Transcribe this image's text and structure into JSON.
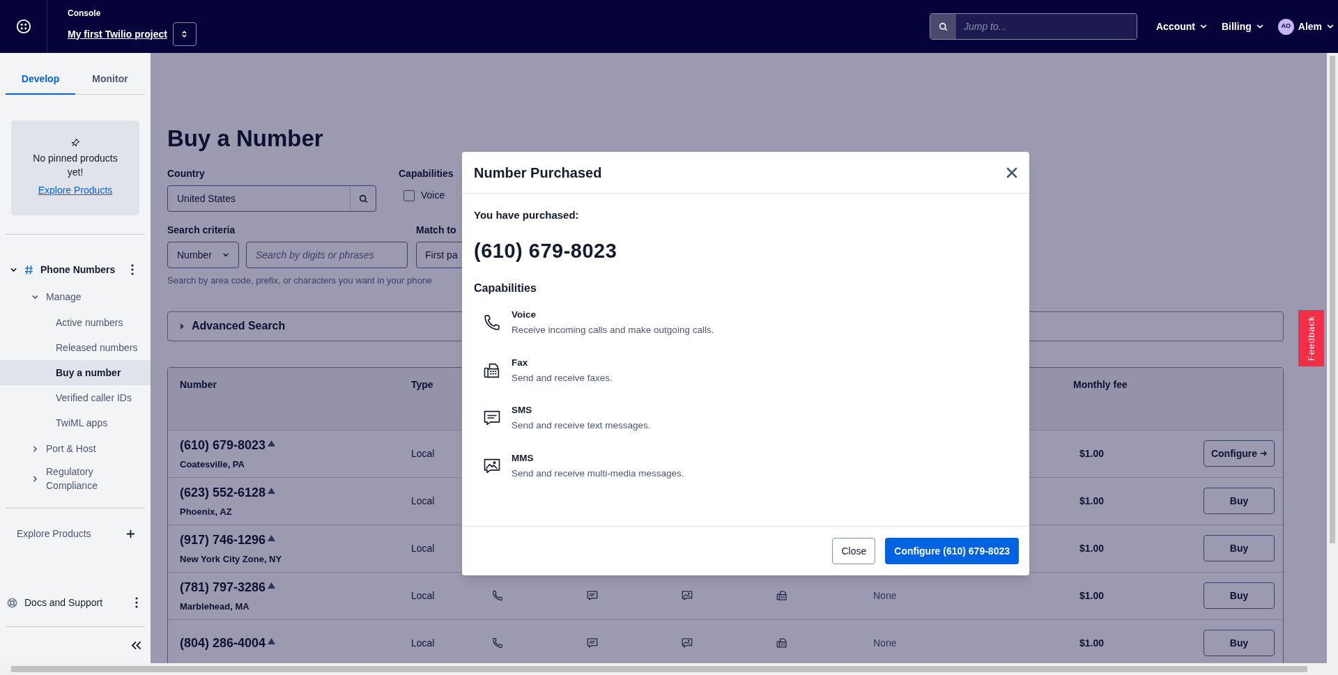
{
  "topbar": {
    "section": "Console",
    "project": "My first Twilio project",
    "search": {
      "placeholder": "Jump to..."
    },
    "menus": [
      "Account",
      "Billing"
    ],
    "user": {
      "initials": "AO",
      "name": "Alem"
    }
  },
  "sidebar": {
    "tabs": [
      {
        "label": "Develop",
        "selected": true
      },
      {
        "label": "Monitor",
        "selected": false
      }
    ],
    "pinned": {
      "message": "No pinned products yet!",
      "link": "Explore Products"
    },
    "tree": [
      {
        "label": "Phone Numbers",
        "expanded": true,
        "children": [
          {
            "label": "Manage",
            "expanded": true,
            "children": [
              {
                "label": "Active numbers",
                "selected": false
              },
              {
                "label": "Released numbers",
                "selected": false
              },
              {
                "label": "Buy a number",
                "selected": true
              },
              {
                "label": "Verified caller IDs",
                "selected": false
              },
              {
                "label": "TwiML apps",
                "selected": false
              }
            ]
          },
          {
            "label": "Port & Host",
            "expanded": false
          },
          {
            "label": "Regulatory Compliance",
            "expanded": false
          }
        ]
      }
    ],
    "explore": "Explore Products",
    "docs": "Docs and Support"
  },
  "page": {
    "title": "Buy a Number",
    "country": {
      "label": "Country",
      "value": "United States"
    },
    "capabilities": {
      "label": "Capabilities",
      "options": [
        {
          "label": "Voice",
          "checked": false
        }
      ]
    },
    "search_criteria": {
      "label": "Search criteria",
      "type": "Number",
      "placeholder": "Search by digits or phrases",
      "hint": "Search by area code, prefix, or characters you want in your phone"
    },
    "match_to": {
      "label": "Match to",
      "value": "First pa"
    },
    "advanced_search": {
      "label": "Advanced Search",
      "expanded": false
    }
  },
  "table": {
    "columns": [
      {
        "label": "Number"
      },
      {
        "label": "Type"
      },
      {
        "label": "Monthly fee"
      }
    ],
    "rows": [
      {
        "number": "(610) 679-8023",
        "location": "Coatesville, PA",
        "type": "Local",
        "fee": "$1.00",
        "action": {
          "kind": "configure",
          "label": "Configure"
        }
      },
      {
        "number": "(623) 552-6128",
        "location": "Phoenix, AZ",
        "type": "Local",
        "fee": "$1.00",
        "action": {
          "kind": "buy",
          "label": "Buy"
        }
      },
      {
        "number": "(917) 746-1296",
        "location": "New York City Zone, NY",
        "type": "Local",
        "fee": "$1.00",
        "action": {
          "kind": "buy",
          "label": "Buy"
        }
      },
      {
        "number": "(781) 797-3286",
        "location": "Marblehead, MA",
        "type": "Local",
        "address_requirement": "None",
        "fee": "$1.00",
        "action": {
          "kind": "buy",
          "label": "Buy"
        }
      },
      {
        "number": "(804) 286-4004",
        "type": "Local",
        "address_requirement": "None",
        "fee": "$1.00",
        "action": {
          "kind": "buy",
          "label": "Buy"
        }
      }
    ]
  },
  "feedback": "Feedback",
  "modal": {
    "title": "Number Purchased",
    "intro": "You have purchased:",
    "number": "(610) 679-8023",
    "capabilities_title": "Capabilities",
    "capabilities": [
      {
        "kind": "voice",
        "name": "Voice",
        "description": "Receive incoming calls and make outgoing calls."
      },
      {
        "kind": "fax",
        "name": "Fax",
        "description": "Send and receive faxes."
      },
      {
        "kind": "sms",
        "name": "SMS",
        "description": "Send and receive text messages."
      },
      {
        "kind": "mms",
        "name": "MMS",
        "description": "Send and receive multi-media messages."
      }
    ],
    "buttons": [
      {
        "kind": "secondary",
        "label": "Close"
      },
      {
        "kind": "primary",
        "label": "Configure (610) 679-8023"
      }
    ]
  }
}
